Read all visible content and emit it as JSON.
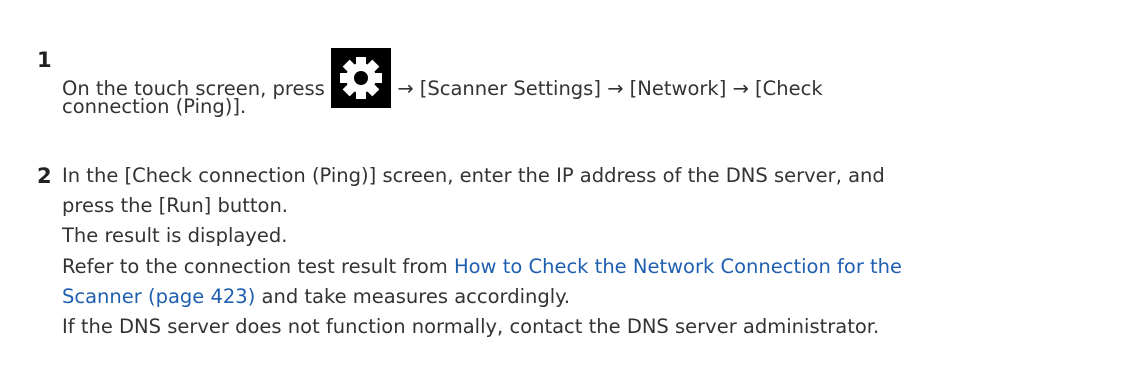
{
  "steps": [
    {
      "number": "1",
      "text_before_icon": "On the touch screen, press",
      "icon": "gear-icon",
      "text_after_icon": "→ [Scanner Settings] → [Network] → [Check",
      "line2": "connection (Ping)]."
    },
    {
      "number": "2",
      "line1": "In the [Check connection (Ping)] screen, enter the IP address of the DNS server, and",
      "line2": "press the [Run] button.",
      "line3": "The result is displayed.",
      "line4_before_link": "Refer to the connection test result from",
      "link_part1": "How to Check the Network Connection for the",
      "link_part2": "Scanner (page 423)",
      "line5_after_link": "and take measures accordingly.",
      "line6": "If the DNS server does not function normally, contact the DNS server administrator."
    }
  ],
  "colors": {
    "text": "#333333",
    "link": "#1f5fb0",
    "icon_background": "#000000",
    "icon_foreground": "#ffffff"
  }
}
